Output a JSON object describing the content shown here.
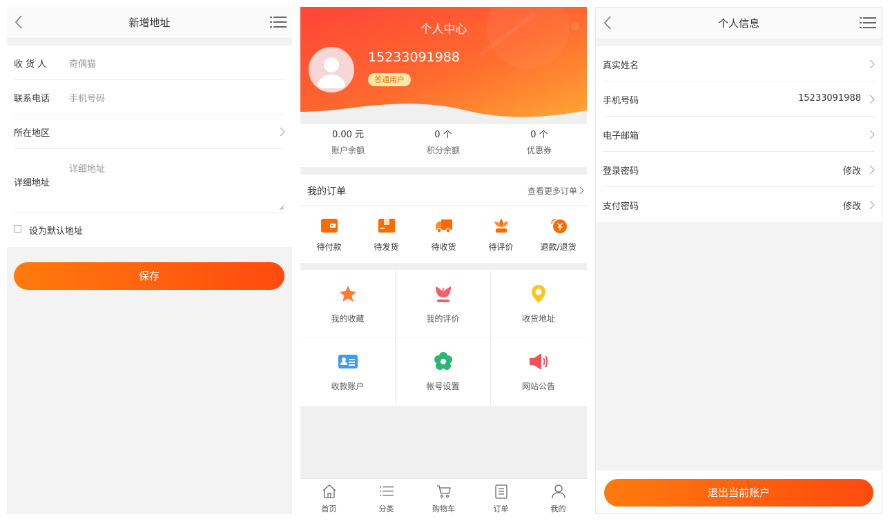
{
  "address_screen": {
    "title": "新增地址",
    "fields": [
      {
        "label": "收 货 人",
        "placeholder": "奇偶猫"
      },
      {
        "label": "联系电话",
        "placeholder": "手机号码"
      },
      {
        "label": "所在地区",
        "placeholder": ""
      },
      {
        "label": "详细地址",
        "placeholder": "详细地址"
      }
    ],
    "default_label": "设为默认地址",
    "default_checked": false,
    "save_label": "保存"
  },
  "profile_screen": {
    "title": "个人中心",
    "phone": "15233091988",
    "user_level": "普通用户",
    "stats": [
      {
        "value": "0.00 元",
        "label": "账户余额"
      },
      {
        "value": "0 个",
        "label": "积分余额"
      },
      {
        "value": "0 个",
        "label": "优惠券"
      }
    ],
    "orders_title": "我的订单",
    "orders_more": "查看更多订单",
    "order_items": [
      {
        "label": "待付款",
        "icon": "wallet-icon"
      },
      {
        "label": "待发货",
        "icon": "package-icon"
      },
      {
        "label": "待收货",
        "icon": "truck-icon"
      },
      {
        "label": "待评价",
        "icon": "flower-icon"
      },
      {
        "label": "退款/退货",
        "icon": "refund-icon"
      }
    ],
    "grid_items": [
      {
        "label": "我的收藏",
        "icon": "star-icon"
      },
      {
        "label": "我的评价",
        "icon": "tulip-icon"
      },
      {
        "label": "收货地址",
        "icon": "location-pin-icon"
      },
      {
        "label": "收款账户",
        "icon": "id-card-icon"
      },
      {
        "label": "帐号设置",
        "icon": "gear-flower-icon"
      },
      {
        "label": "网站公告",
        "icon": "megaphone-icon"
      }
    ],
    "tabs": [
      {
        "label": "首页",
        "icon": "home-icon"
      },
      {
        "label": "分类",
        "icon": "list-icon"
      },
      {
        "label": "购物车",
        "icon": "cart-icon"
      },
      {
        "label": "订单",
        "icon": "clipboard-icon"
      },
      {
        "label": "我的",
        "icon": "user-icon"
      }
    ],
    "colors": {
      "accent": "#ff5a2a",
      "accent_end": "#ff9a30"
    }
  },
  "info_screen": {
    "title": "个人信息",
    "rows": [
      {
        "label": "真实姓名",
        "value": ""
      },
      {
        "label": "手机号码",
        "value": "15233091988"
      },
      {
        "label": "电子邮箱",
        "value": ""
      },
      {
        "label": "登录密码",
        "value": "修改"
      },
      {
        "label": "支付密码",
        "value": "修改"
      }
    ],
    "logout_label": "退出当前账户"
  }
}
